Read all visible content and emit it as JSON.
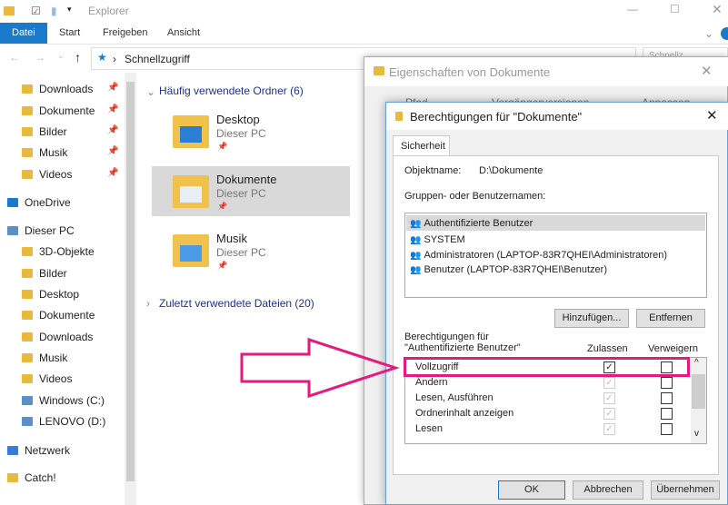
{
  "explorer": {
    "title": "Explorer",
    "ribbon_tabs": [
      "Datei",
      "Start",
      "Freigeben",
      "Ansicht"
    ],
    "breadcrumb": "Schnellzugriff",
    "search_placeholder": "Schnellz...",
    "sidebar": [
      {
        "label": "Downloads",
        "pinned": true
      },
      {
        "label": "Dokumente",
        "pinned": true
      },
      {
        "label": "Bilder",
        "pinned": true
      },
      {
        "label": "Musik",
        "pinned": true
      },
      {
        "label": "Videos",
        "pinned": true
      },
      {
        "label": "OneDrive"
      },
      {
        "label": "Dieser PC"
      },
      {
        "label": "3D-Objekte"
      },
      {
        "label": "Bilder"
      },
      {
        "label": "Desktop"
      },
      {
        "label": "Dokumente"
      },
      {
        "label": "Downloads"
      },
      {
        "label": "Musik"
      },
      {
        "label": "Videos"
      },
      {
        "label": "Windows (C:)"
      },
      {
        "label": "LENOVO (D:)"
      },
      {
        "label": "Netzwerk"
      },
      {
        "label": "Catch!"
      }
    ],
    "frequent_header": "Häufig verwendete Ordner (6)",
    "recent_header": "Zuletzt verwendete Dateien (20)",
    "folders": [
      {
        "name": "Desktop",
        "location": "Dieser PC"
      },
      {
        "name": "Dokumente",
        "location": "Dieser PC",
        "selected": true
      },
      {
        "name": "Musik",
        "location": "Dieser PC"
      }
    ]
  },
  "properties": {
    "title": "Eigenschaften von Dokumente",
    "tabs": [
      "Pfad",
      "Vorgängerversionen",
      "Anpassen"
    ]
  },
  "permissions": {
    "title": "Berechtigungen für \"Dokumente\"",
    "tab": "Sicherheit",
    "object_label": "Objektname:",
    "object_value": "D:\\Dokumente",
    "groups_label": "Gruppen- oder Benutzernamen:",
    "groups": [
      "Authentifizierte Benutzer",
      "SYSTEM",
      "Administratoren (LAPTOP-83R7QHEI\\Administratoren)",
      "Benutzer (LAPTOP-83R7QHEI\\Benutzer)"
    ],
    "add_button": "Hinzufügen...",
    "remove_button": "Entfernen",
    "perm_label": "Berechtigungen für \"Authentifizierte Benutzer\"",
    "allow_header": "Zulassen",
    "deny_header": "Verweigern",
    "perms": [
      {
        "name": "Vollzugriff",
        "allow": true,
        "allow_disabled": false,
        "deny": false
      },
      {
        "name": "Ändern",
        "allow": true,
        "allow_disabled": true,
        "deny": false
      },
      {
        "name": "Lesen, Ausführen",
        "allow": true,
        "allow_disabled": true,
        "deny": false
      },
      {
        "name": "Ordnerinhalt anzeigen",
        "allow": true,
        "allow_disabled": true,
        "deny": false
      },
      {
        "name": "Lesen",
        "allow": true,
        "allow_disabled": true,
        "deny": false
      }
    ],
    "ok": "OK",
    "cancel": "Abbrechen",
    "apply": "Übernehmen"
  },
  "colors": {
    "accent": "#1979ca",
    "highlight": "#e6197d"
  }
}
